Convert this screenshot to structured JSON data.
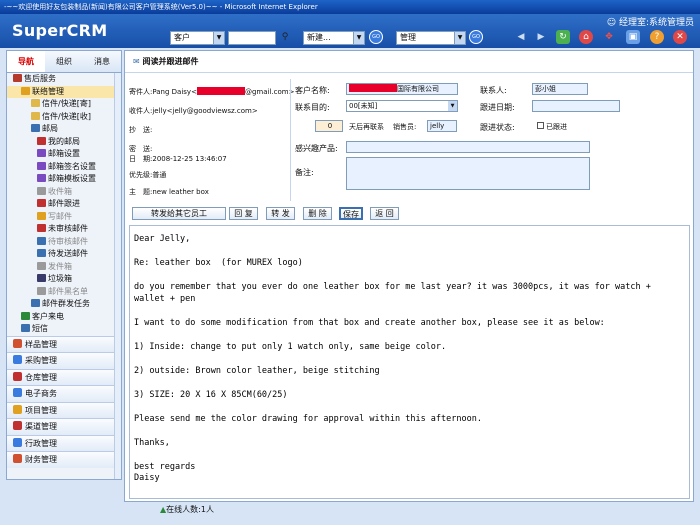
{
  "window": {
    "title": "-~~欢迎使用好友包装制品(新闻)有限公司客户管理系统(Ver5.0)~~ - Microsoft Internet Explorer"
  },
  "app": {
    "brand": "SuperCRM",
    "login_text": "经理室:系统管理员"
  },
  "toolbar": {
    "customer_label": "客户",
    "new_label": "新建...",
    "manage_label": "管理",
    "search_value": ""
  },
  "sidebar": {
    "tabs": [
      {
        "label": "导航"
      },
      {
        "label": "组织"
      },
      {
        "label": "消息"
      }
    ],
    "items": [
      {
        "label": "售后服务",
        "level": 0,
        "color": "#b53a2c"
      },
      {
        "label": "联络管理",
        "level": 1,
        "color": "#e0a020",
        "selected": true
      },
      {
        "label": "信件/快递[寄]",
        "level": 2,
        "color": "#e0b84a"
      },
      {
        "label": "信件/快递[收]",
        "level": 2,
        "color": "#e0b84a"
      },
      {
        "label": "邮局",
        "level": 2,
        "color": "#3a6fb0"
      },
      {
        "label": "我的邮局",
        "level": 3,
        "color": "#c03030"
      },
      {
        "label": "邮箱设置",
        "level": 3,
        "color": "#7a4ac0"
      },
      {
        "label": "邮箱签名设置",
        "level": 3,
        "color": "#7a4ac0"
      },
      {
        "label": "邮箱模板设置",
        "level": 3,
        "color": "#7a4ac0"
      },
      {
        "label": "收件箱",
        "level": 3,
        "color": "#9a9a9a",
        "dim": true
      },
      {
        "label": "邮件跟进",
        "level": 3,
        "color": "#c03030"
      },
      {
        "label": "写邮件",
        "level": 3,
        "color": "#e0a020",
        "dim": true
      },
      {
        "label": "未审核邮件",
        "level": 3,
        "color": "#c03030"
      },
      {
        "label": "待审核邮件",
        "level": 3,
        "color": "#3a6fb0",
        "dim": true
      },
      {
        "label": "待发送邮件",
        "level": 3,
        "color": "#3a6fb0"
      },
      {
        "label": "发件箱",
        "level": 3,
        "color": "#9a9a9a",
        "dim": true
      },
      {
        "label": "垃圾箱",
        "level": 3,
        "color": "#3a3a6a"
      },
      {
        "label": "邮件黑名单",
        "level": 3,
        "color": "#9a9a9a",
        "dim": true
      },
      {
        "label": "邮件群发任务",
        "level": 2,
        "color": "#3a6fb0"
      },
      {
        "label": "客户来电",
        "level": 1,
        "color": "#2a8a3a"
      },
      {
        "label": "短信",
        "level": 1,
        "color": "#3a6fb0"
      }
    ],
    "groups": [
      {
        "label": "样品管理",
        "color": "#d05030"
      },
      {
        "label": "采购管理",
        "color": "#3a7be0"
      },
      {
        "label": "仓库管理",
        "color": "#c03030"
      },
      {
        "label": "电子商务",
        "color": "#3a7be0"
      },
      {
        "label": "项目管理",
        "color": "#e0a020"
      },
      {
        "label": "渠道管理",
        "color": "#c03030"
      },
      {
        "label": "行政管理",
        "color": "#3a7be0"
      },
      {
        "label": "财务管理",
        "color": "#d05030"
      }
    ]
  },
  "main": {
    "title": "阅读并跟进邮件",
    "sender_label": "寄件人:",
    "sender_prefix": "Pang Daisy<",
    "sender_suffix": "@gmail.com>",
    "recipient_label": "收件人:",
    "recipient_value": "jelly<jelly@goodviewsz.com>",
    "cc_label": "抄　送:",
    "bcc_label": "密　送:",
    "date_label": "日　期:",
    "date_value": "2008-12-25 13:46:07",
    "priority_label": "优先级:",
    "priority_value": "普通",
    "subject_label": "主　题:",
    "subject_value": "new leather box",
    "customer_name_label": "客户名称:",
    "customer_name_suffix": "国际有限公司",
    "contact_label": "联系人:",
    "contact_value": "彭小姐",
    "purpose_label": "联系目的:",
    "purpose_value": "00[未知]",
    "followup_date_label": "跟进日期:",
    "followup_date_value": "",
    "days_value": "0",
    "days_text": "天后再联系",
    "sales_label": "销售员:",
    "sales_value": "jelly",
    "followup_status_label": "跟进状态:",
    "followup_done_label": "已跟进",
    "product_label": "感兴趣产品:",
    "product_value": "",
    "remark_label": "备注:",
    "remark_value": ""
  },
  "actions": [
    {
      "label": "转发给其它员工"
    },
    {
      "label": "回 复"
    },
    {
      "label": "转 发"
    },
    {
      "label": "删 除"
    },
    {
      "label": "保存"
    },
    {
      "label": "返 回"
    }
  ],
  "email_body": [
    "Dear Jelly,",
    "Re: leather box  (for MUREX logo)",
    "do you remember that you ever do one leather box for me last year? it was 3000pcs, it was for watch + wallet + pen",
    "I want to do some modification from that box and create another box, please see it as below:",
    "1) Inside: change to put only 1 watch only, same beige color.",
    "2) outside: Brown color leather, beige stitching",
    "3) SIZE: 20 X 16 X 85CM(60/25)",
    "Please send me the color drawing for approval within this afternoon.",
    "Thanks,",
    "best regards\nDaisy"
  ],
  "status": {
    "online": "在线人数:1人"
  }
}
